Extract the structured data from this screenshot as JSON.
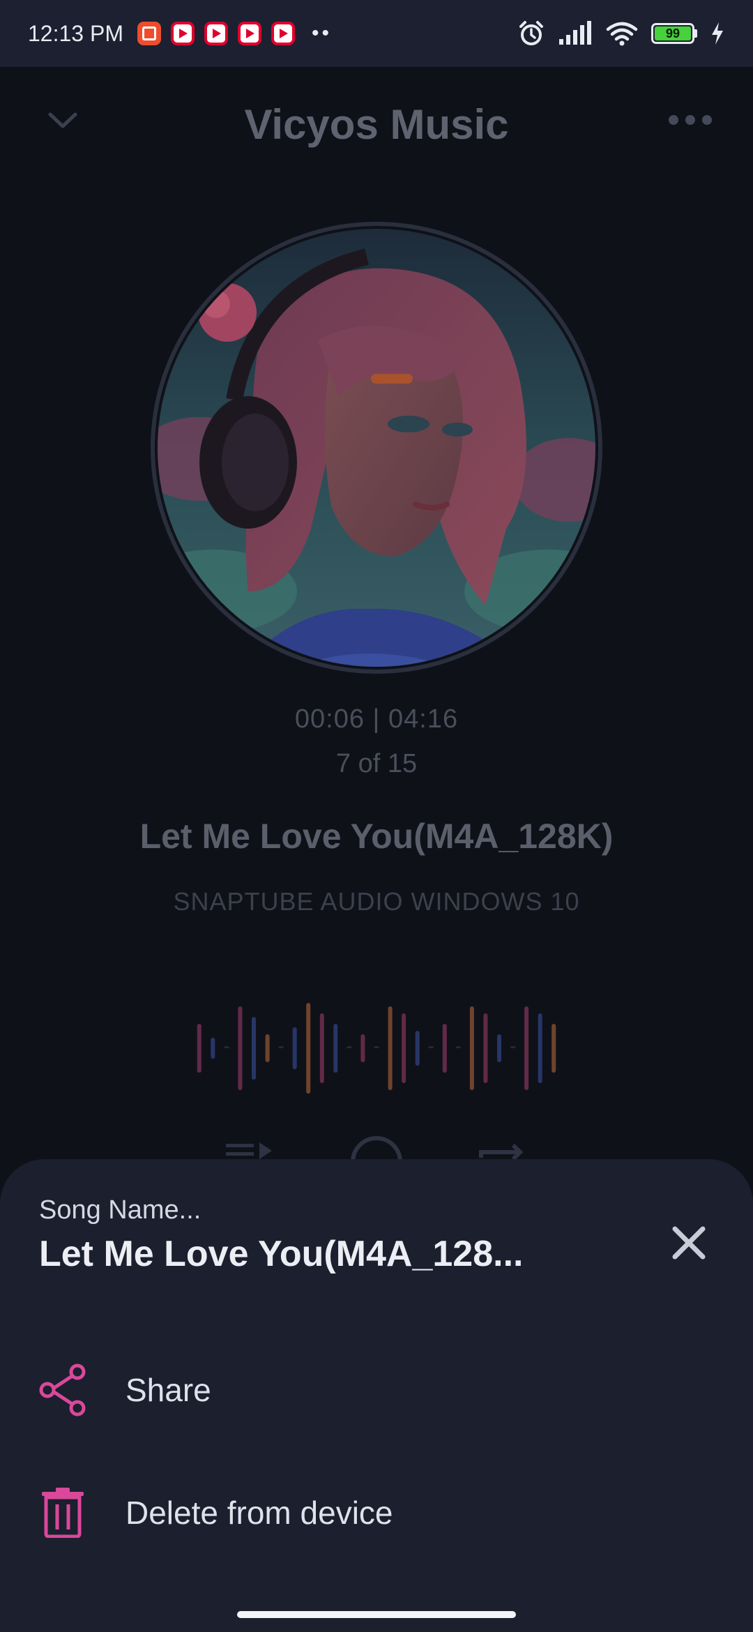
{
  "status_bar": {
    "time": "12:13 PM",
    "dots": "••",
    "battery_level": "99",
    "icons": [
      "shopee-icon",
      "youtube-icon",
      "youtube-icon",
      "youtube-icon",
      "youtube-icon",
      "alarm-icon",
      "signal-icon",
      "wifi-icon",
      "battery-icon",
      "charging-icon"
    ]
  },
  "player": {
    "title": "Vicyos Music",
    "elapsed_total": "00:06 | 04:16",
    "position": "7 of 15",
    "song_title": "Let Me Love You(M4A_128K)",
    "artist": "SNAPTUBE AUDIO WINDOWS 10",
    "accent_colors": [
      "#a8406f",
      "#3a56a8",
      "#c0703a"
    ]
  },
  "sheet": {
    "label": "Song Name...",
    "song_name": "Let Me Love You(M4A_128...",
    "items": [
      {
        "label": "Share",
        "icon": "share-icon"
      },
      {
        "label": "Delete from device",
        "icon": "trash-icon"
      }
    ],
    "icon_color": "#d9489a"
  }
}
